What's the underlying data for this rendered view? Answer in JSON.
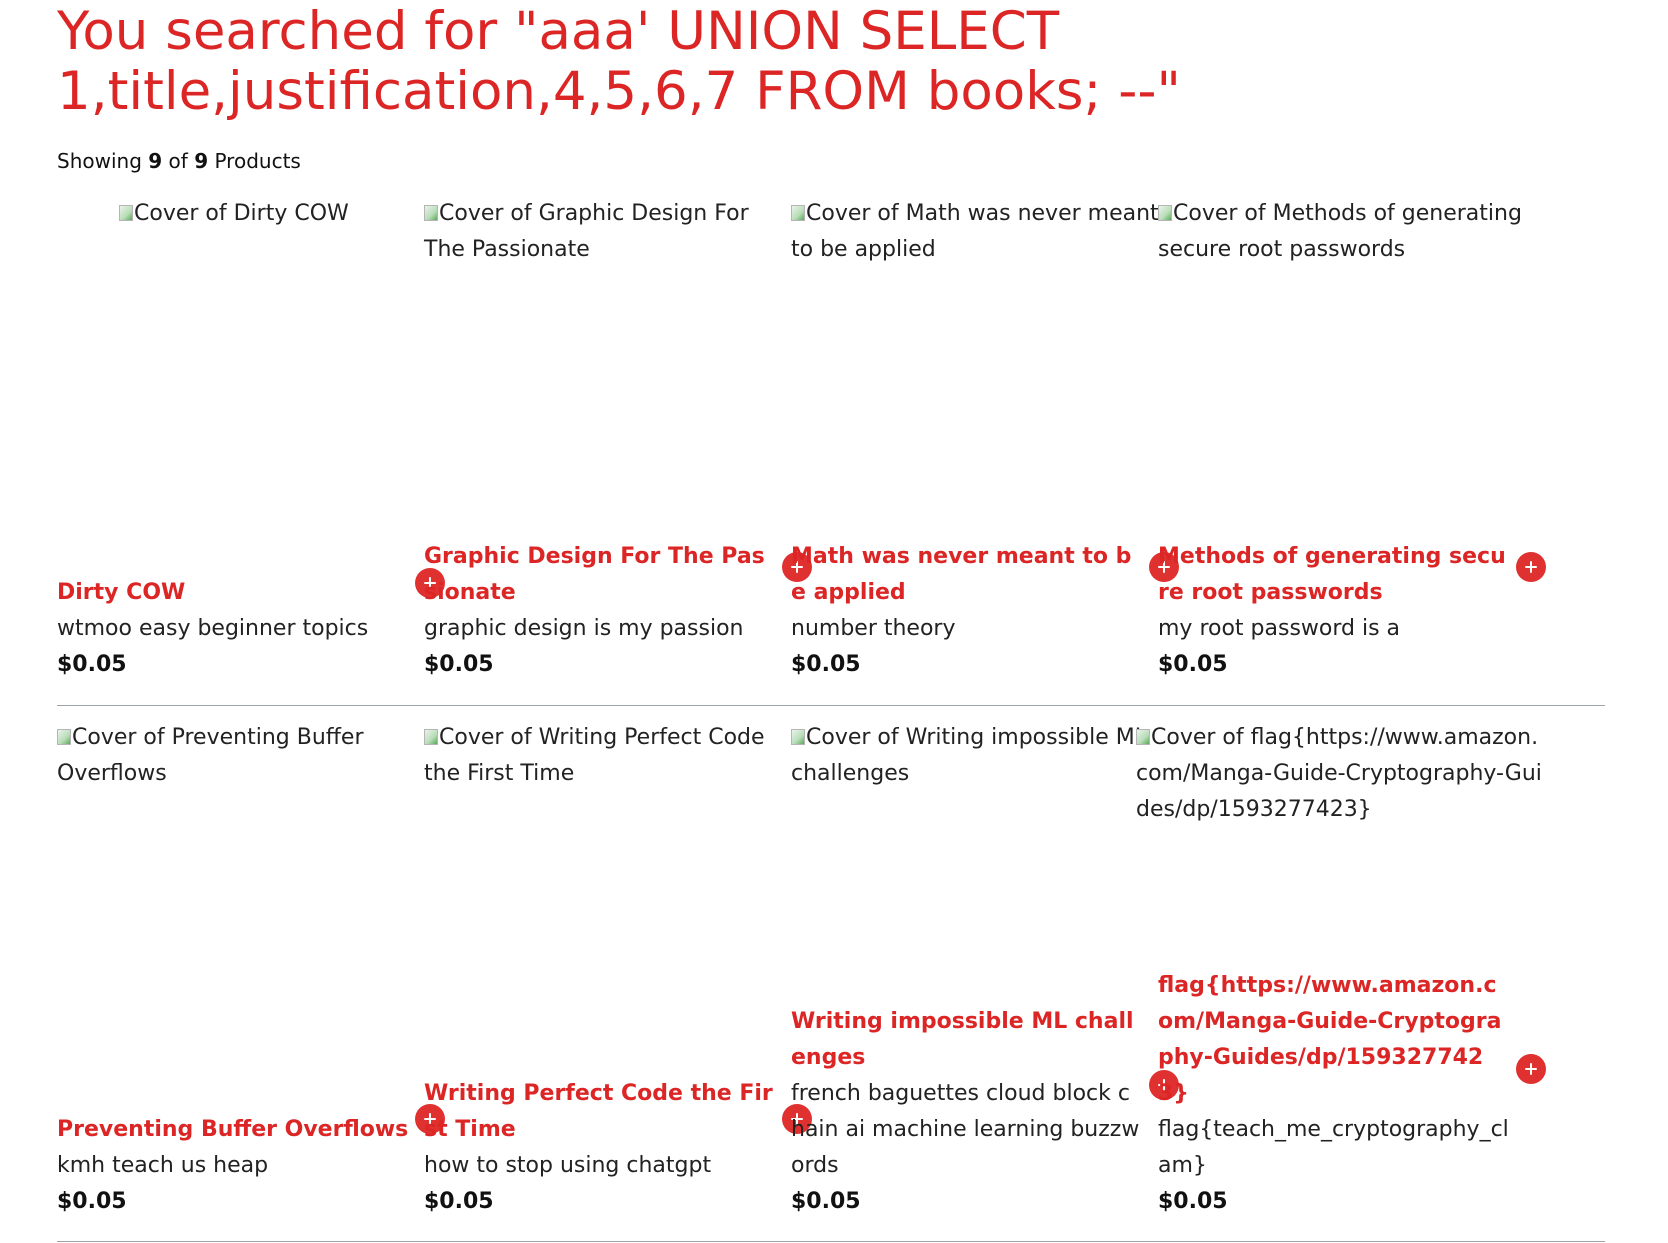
{
  "search": {
    "heading": "You searched for \"aaa' UNION SELECT 1,title,justification,4,5,6,7 FROM books; --\""
  },
  "results": {
    "showing_label": "Showing",
    "shown": "9",
    "of_label": "of",
    "total": "9",
    "products_label": "Products"
  },
  "products": [
    {
      "cover_alt": "Cover of Dirty COW",
      "title": "Dirty COW",
      "description": "wtmoo easy beginner topics",
      "price": "$0.05"
    },
    {
      "cover_alt": "Cover of Graphic Design For The Passionate",
      "title": "Graphic Design For The Passionate",
      "description": "graphic design is my passion",
      "price": "$0.05"
    },
    {
      "cover_alt": "Cover of Math was never meant to be applied",
      "title": "Math was never meant to be applied",
      "description": "number theory",
      "price": "$0.05"
    },
    {
      "cover_alt": "Cover of Methods of generating secure root passwords",
      "title": "Methods of generating secure root passwords",
      "description": "my root password is a",
      "price": "$0.05"
    },
    {
      "cover_alt": "Cover of Preventing Buffer Overflows",
      "title": "Preventing Buffer Overflows",
      "description": "kmh teach us heap",
      "price": "$0.05"
    },
    {
      "cover_alt": "Cover of Writing Perfect Code the First Time",
      "title": "Writing Perfect Code the First Time",
      "description": "how to stop using chatgpt",
      "price": "$0.05"
    },
    {
      "cover_alt": "Cover of Writing impossible ML challenges",
      "title": "Writing impossible ML challenges",
      "description": "french baguettes cloud block chain ai machine learning buzzwords",
      "price": "$0.05"
    },
    {
      "cover_alt": "Cover of flag{https://www.amazon.com/Manga-Guide-Cryptography-Guides/dp/1593277423}",
      "title": "flag{https://www.amazon.com/Manga-Guide-Cryptography-Guides/dp/1593277423}",
      "description": "flag{teach_me_cryptography_clam}",
      "price": "$0.05"
    }
  ],
  "colors": {
    "accent": "#dc2626",
    "button": "#e03131",
    "divider": "#9ca3af"
  },
  "icons": {
    "add": "plus-icon",
    "broken_image": "broken-image-icon"
  }
}
